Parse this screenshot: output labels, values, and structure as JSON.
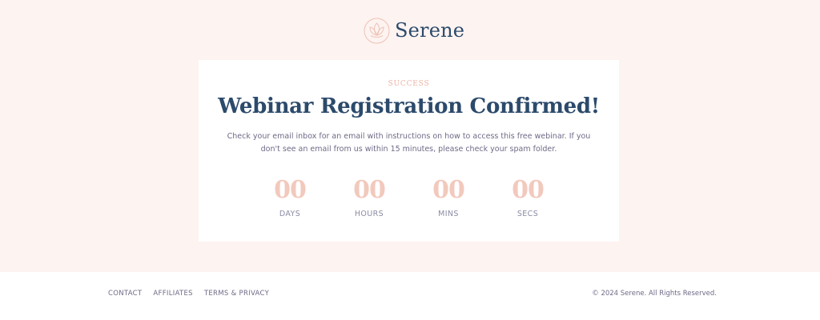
{
  "brand": {
    "name": "Serene",
    "logo_icon": "lotus-icon",
    "logo_color": "#edc2b3"
  },
  "card": {
    "eyebrow": "SUCCESS",
    "title": "Webinar Registration Confirmed!",
    "description": "Check your email inbox for an email with instructions on how to access this free webinar. If you don't see an email from us within 15 minutes, please check your spam folder."
  },
  "countdown": {
    "days": {
      "value": "00",
      "label": "DAYS"
    },
    "hours": {
      "value": "00",
      "label": "HOURS"
    },
    "mins": {
      "value": "00",
      "label": "MINS"
    },
    "secs": {
      "value": "00",
      "label": "SECS"
    }
  },
  "footer": {
    "links": [
      {
        "label": "CONTACT"
      },
      {
        "label": "AFFILIATES"
      },
      {
        "label": "TERMS & PRIVACY"
      }
    ],
    "copyright": "© 2024 Serene. All Rights Reserved."
  },
  "colors": {
    "page_background": "#fdf3f1",
    "card_background": "#ffffff",
    "title_navy": "#2c4a6b",
    "accent_peach": "#f2c9bd",
    "eyebrow_pink": "#ebb3a5",
    "body_text": "#6e6a86",
    "muted_label": "#8a8ca3"
  }
}
